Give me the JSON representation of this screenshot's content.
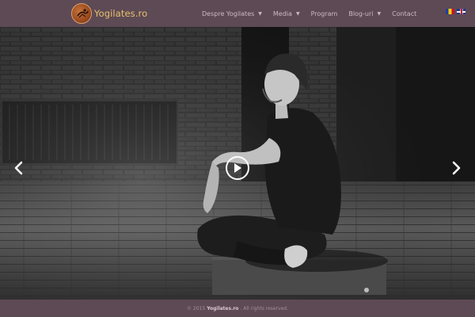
{
  "header": {
    "logo_text": "Yogilates.ro",
    "nav": [
      {
        "label": "Despre Yogilates",
        "has_dropdown": true
      },
      {
        "label": "Media",
        "has_dropdown": true
      },
      {
        "label": "Program",
        "has_dropdown": false
      },
      {
        "label": "Blog-uri",
        "has_dropdown": true
      },
      {
        "label": "Contact",
        "has_dropdown": false
      }
    ],
    "flags": [
      "romanian-flag-icon",
      "uk-flag-icon"
    ]
  },
  "hero": {
    "prev_icon": "chevron-left-icon",
    "next_icon": "chevron-right-icon",
    "play_icon": "play-icon"
  },
  "footer": {
    "prefix": "© 2015",
    "brand": "Yogilates.ro",
    "suffix": ". All rights reserved."
  },
  "colors": {
    "header_bg": "#5e4a55",
    "logo_text": "#e7c06b",
    "nav_text": "#c9b8c2"
  }
}
